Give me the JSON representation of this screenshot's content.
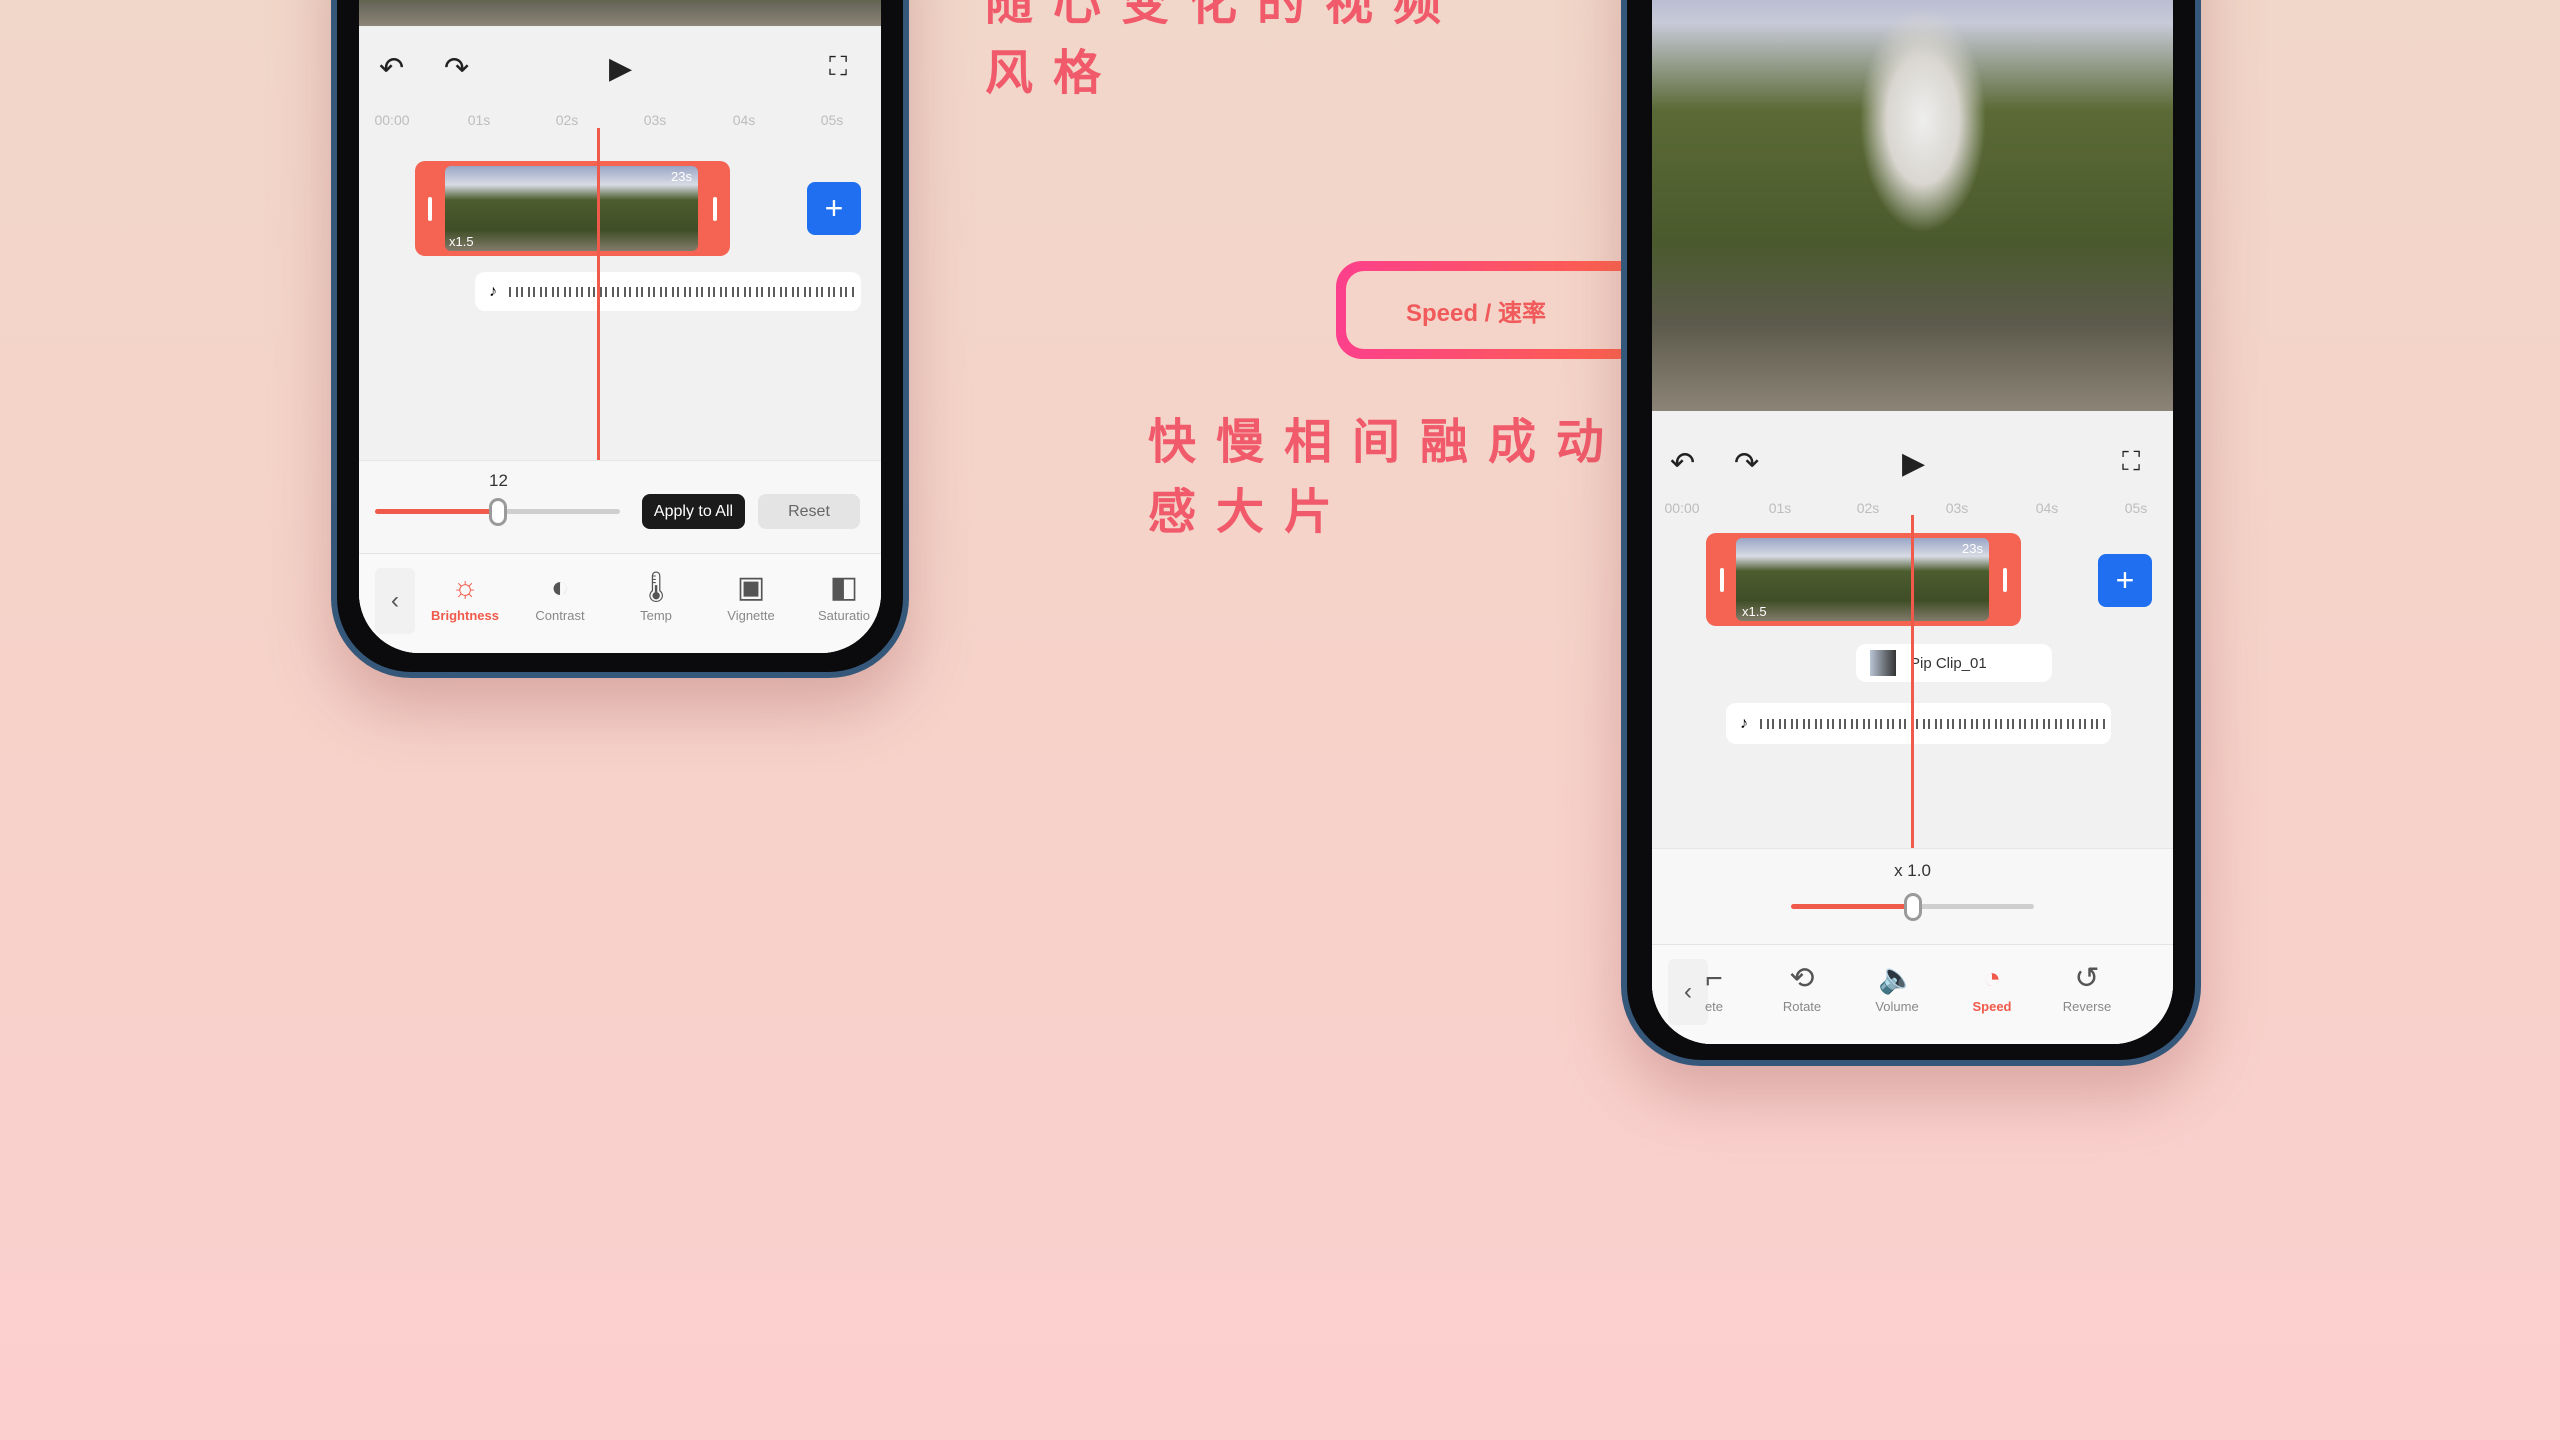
{
  "headlines": {
    "style_line1": "随心变化的视频",
    "style_line2": "风格",
    "speed_line1": "快慢相间融成动",
    "speed_line2": "感大片"
  },
  "speed_tag": "Speed / 速率",
  "colors": {
    "accent": "#f05a4a",
    "add_button": "#1f6ff0",
    "headline": "#f05a6a"
  },
  "left_phone": {
    "timeline_ticks": [
      "00:00",
      "01s",
      "02s",
      "03s",
      "04s",
      "05s"
    ],
    "clip": {
      "speed": "x1.5",
      "duration": "23s"
    },
    "adjust_value": "12",
    "adjust_level_percent": 50,
    "apply_all_label": "Apply to All",
    "reset_label": "Reset",
    "tools": [
      {
        "label": "Brightness",
        "icon": "sun-icon",
        "active": true
      },
      {
        "label": "Contrast",
        "icon": "contrast-icon"
      },
      {
        "label": "Temp",
        "icon": "thermometer-icon"
      },
      {
        "label": "Vignette",
        "icon": "vignette-icon"
      },
      {
        "label": "Saturatio",
        "icon": "saturation-icon"
      }
    ]
  },
  "right_phone": {
    "timeline_ticks": [
      "00:00",
      "01s",
      "02s",
      "03s",
      "04s",
      "05s"
    ],
    "clip": {
      "speed": "x1.5",
      "duration": "23s"
    },
    "pip_label": "Pip Clip_01",
    "speed_value": "x 1.0",
    "speed_level_percent": 50,
    "tools": [
      {
        "label": "ete",
        "icon": "delete-icon"
      },
      {
        "label": "Rotate",
        "icon": "rotate-icon"
      },
      {
        "label": "Volume",
        "icon": "volume-icon"
      },
      {
        "label": "Speed",
        "icon": "speedometer-icon",
        "active": true
      },
      {
        "label": "Reverse",
        "icon": "reverse-icon"
      }
    ]
  }
}
